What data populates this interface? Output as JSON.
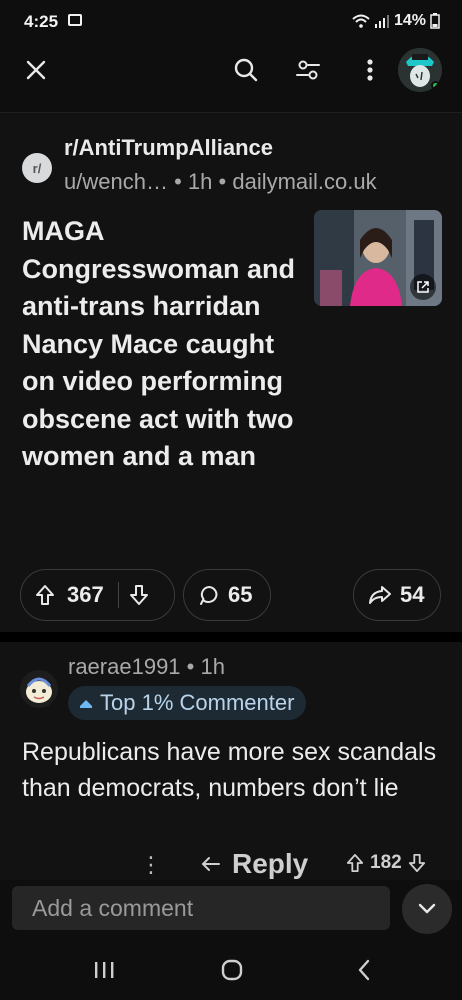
{
  "status_bar": {
    "time": "4:25",
    "battery": "14%"
  },
  "toolbar": {
    "close": "close",
    "search": "search",
    "filter": "filter",
    "more": "more"
  },
  "post": {
    "subreddit": "r/AntiTrumpAlliance",
    "author": "u/wench…",
    "age": "1h",
    "domain": "dailymail.co.uk",
    "title": "MAGA Congresswoman and anti-trans harridan Nancy Mace caught on video performing obscene act with two women and a man",
    "upvotes": "367",
    "comments": "65",
    "shares": "54"
  },
  "comment": {
    "username": "raerae1991",
    "age": "1h",
    "badge": "Top 1% Commenter",
    "text": "Republicans have more sex scandals than democrats, numbers don’t lie",
    "reply_label": "Reply",
    "score": "182"
  },
  "comment_bar": {
    "placeholder": "Add a comment"
  },
  "colors": {
    "background": "#0e0e0e",
    "card": "#121212",
    "online": "#27c24c",
    "badge_bg": "#1d2a34"
  }
}
